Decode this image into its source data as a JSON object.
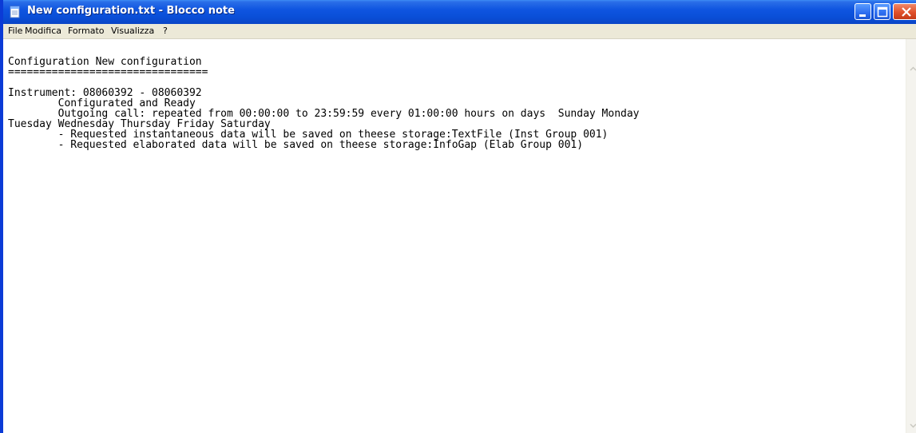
{
  "window": {
    "title": "New configuration.txt - Blocco note",
    "icon": "notepad-icon"
  },
  "menu": {
    "items": [
      "File",
      "Modifica",
      "Formato",
      "Visualizza",
      "?"
    ]
  },
  "document": {
    "content": "Configuration New configuration\n================================\n\nInstrument: 08060392 - 08060392\n\tConfigurated and Ready\n\tOutgoing call: repeated from 00:00:00 to 23:59:59 every 01:00:00 hours on days  Sunday Monday\nTuesday Wednesday Thursday Friday Saturday\n\t- Requested instantaneous data will be saved on theese storage:TextFile (Inst Group 001)\n\t- Requested elaborated data will be saved on theese storage:InfoGap (Elab Group 001)"
  },
  "colors": {
    "titlebar": "#0a4fd8",
    "menubar": "#ece9d8",
    "close_button": "#e0502a",
    "editor_background": "#ffffff"
  }
}
